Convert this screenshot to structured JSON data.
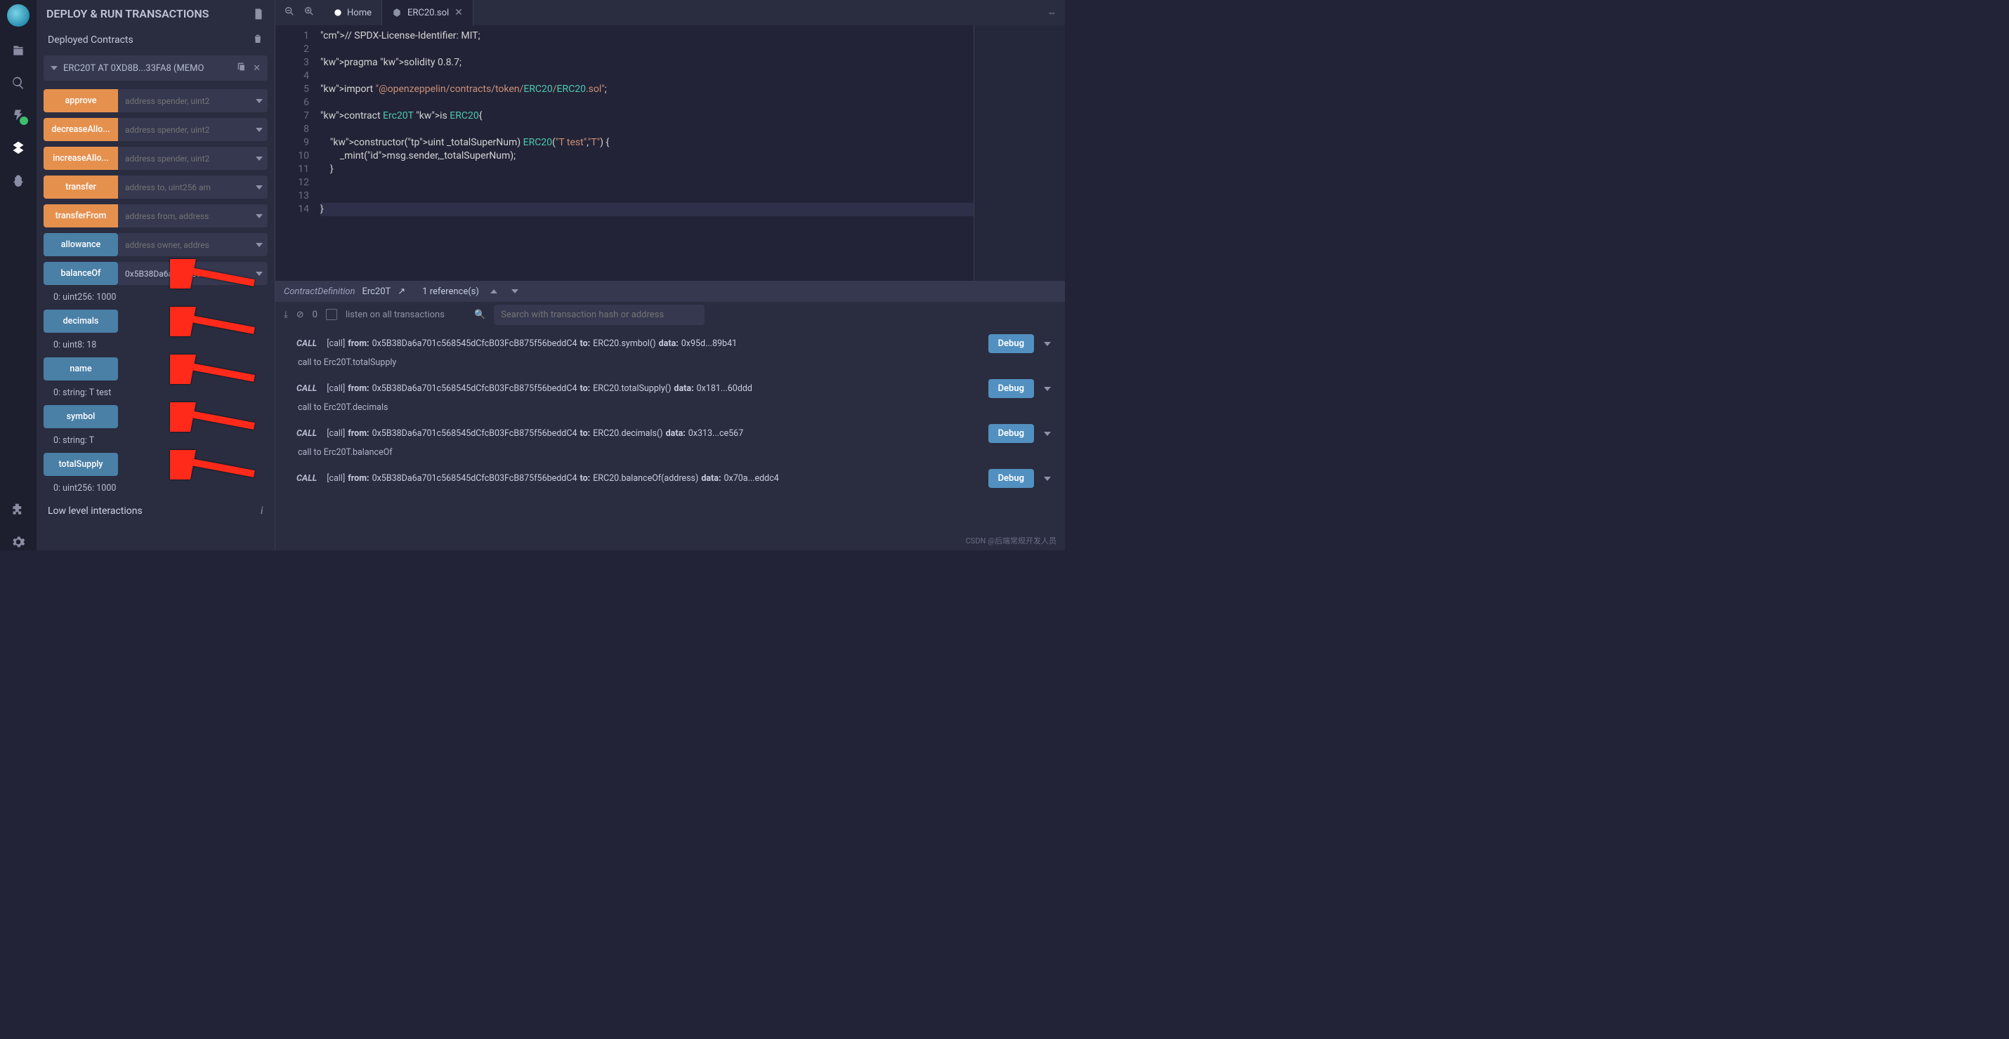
{
  "iconbar": {
    "items": [
      {
        "name": "logo"
      },
      {
        "name": "file-explorer-icon"
      },
      {
        "name": "search-icon"
      },
      {
        "name": "compiler-icon",
        "badge": true
      },
      {
        "name": "deploy-icon",
        "active": true
      },
      {
        "name": "debugger-icon"
      }
    ],
    "bottom": [
      {
        "name": "plugin-icon"
      },
      {
        "name": "settings-icon"
      }
    ]
  },
  "panel": {
    "title": "DEPLOY & RUN TRANSACTIONS",
    "section": "Deployed Contracts",
    "contract_label": "ERC20T AT 0XD8B...33FA8 (MEMO",
    "functions": [
      {
        "label": "approve",
        "placeholder": "address spender, uint2",
        "kind": "orange",
        "input": true
      },
      {
        "label": "decreaseAllo...",
        "placeholder": "address spender, uint2",
        "kind": "orange",
        "input": true
      },
      {
        "label": "increaseAllo...",
        "placeholder": "address spender, uint2",
        "kind": "orange",
        "input": true
      },
      {
        "label": "transfer",
        "placeholder": "address to, uint256 am",
        "kind": "orange",
        "input": true
      },
      {
        "label": "transferFrom",
        "placeholder": "address from, address",
        "kind": "orange",
        "input": true
      },
      {
        "label": "allowance",
        "placeholder": "address owner, addres",
        "kind": "blue",
        "input": true
      },
      {
        "label": "balanceOf",
        "value": "0x5B38Da6a701c568",
        "kind": "blue",
        "input": true,
        "arrow": true
      },
      {
        "result": "0: uint256: 1000"
      },
      {
        "label": "decimals",
        "kind": "blue",
        "input": false,
        "arrow": true
      },
      {
        "result": "0: uint8: 18"
      },
      {
        "label": "name",
        "kind": "blue",
        "input": false,
        "arrow": true
      },
      {
        "result": "0: string: T test"
      },
      {
        "label": "symbol",
        "kind": "blue",
        "input": false,
        "arrow": true
      },
      {
        "result": "0: string: T"
      },
      {
        "label": "totalSupply",
        "kind": "blue",
        "input": false,
        "arrow": true
      },
      {
        "result": "0: uint256: 1000"
      }
    ],
    "lowlevel": "Low level interactions"
  },
  "tabs": {
    "home": "Home",
    "file": "ERC20.sol"
  },
  "code": {
    "lines": [
      "// SPDX-License-Identifier: MIT;",
      "",
      "pragma solidity 0.8.7;",
      "",
      "import \"@openzeppelin/contracts/token/ERC20/ERC20.sol\";",
      "",
      "contract Erc20T is ERC20{",
      "",
      "    constructor(uint _totalSuperNum) ERC20(\"T test\",\"T\") {",
      "        _mint(msg.sender,_totalSuperNum);",
      "    }",
      "",
      "",
      "}"
    ]
  },
  "refbar": {
    "kind": "ContractDefinition",
    "name": "Erc20T",
    "refs": "1 reference(s)"
  },
  "termtools": {
    "count": "0",
    "listen": "listen on all transactions",
    "search_placeholder": "Search with transaction hash or address"
  },
  "terminal": {
    "entries": [
      {
        "from": "0x5B38Da6a701c568545dCfcB03FcB875f56beddC4",
        "to": "ERC20.symbol()",
        "dlabel": "data:",
        "data": "0x95d...89b41",
        "sub": "call to Erc20T.totalSupply"
      },
      {
        "from": "0x5B38Da6a701c568545dCfcB03FcB875f56beddC4",
        "to": "ERC20.totalSupply()",
        "dlabel": "data:",
        "data": "0x181...60ddd",
        "sub": "call to Erc20T.decimals"
      },
      {
        "from": "0x5B38Da6a701c568545dCfcB03FcB875f56beddC4",
        "to": "ERC20.decimals()",
        "dlabel": "data:",
        "data": "0x313...ce567",
        "sub": "call to Erc20T.balanceOf"
      },
      {
        "from": "0x5B38Da6a701c568545dCfcB03FcB875f56beddC4",
        "to": "ERC20.balanceOf(address)",
        "dlabel": "data:",
        "data": "0x70a...eddc4",
        "sub": ""
      }
    ],
    "call_tag": "CALL",
    "bracket": "[call]",
    "from_label": "from:",
    "to_label": "to:",
    "debug": "Debug"
  },
  "watermark": "CSDN @后端常规开发人员"
}
